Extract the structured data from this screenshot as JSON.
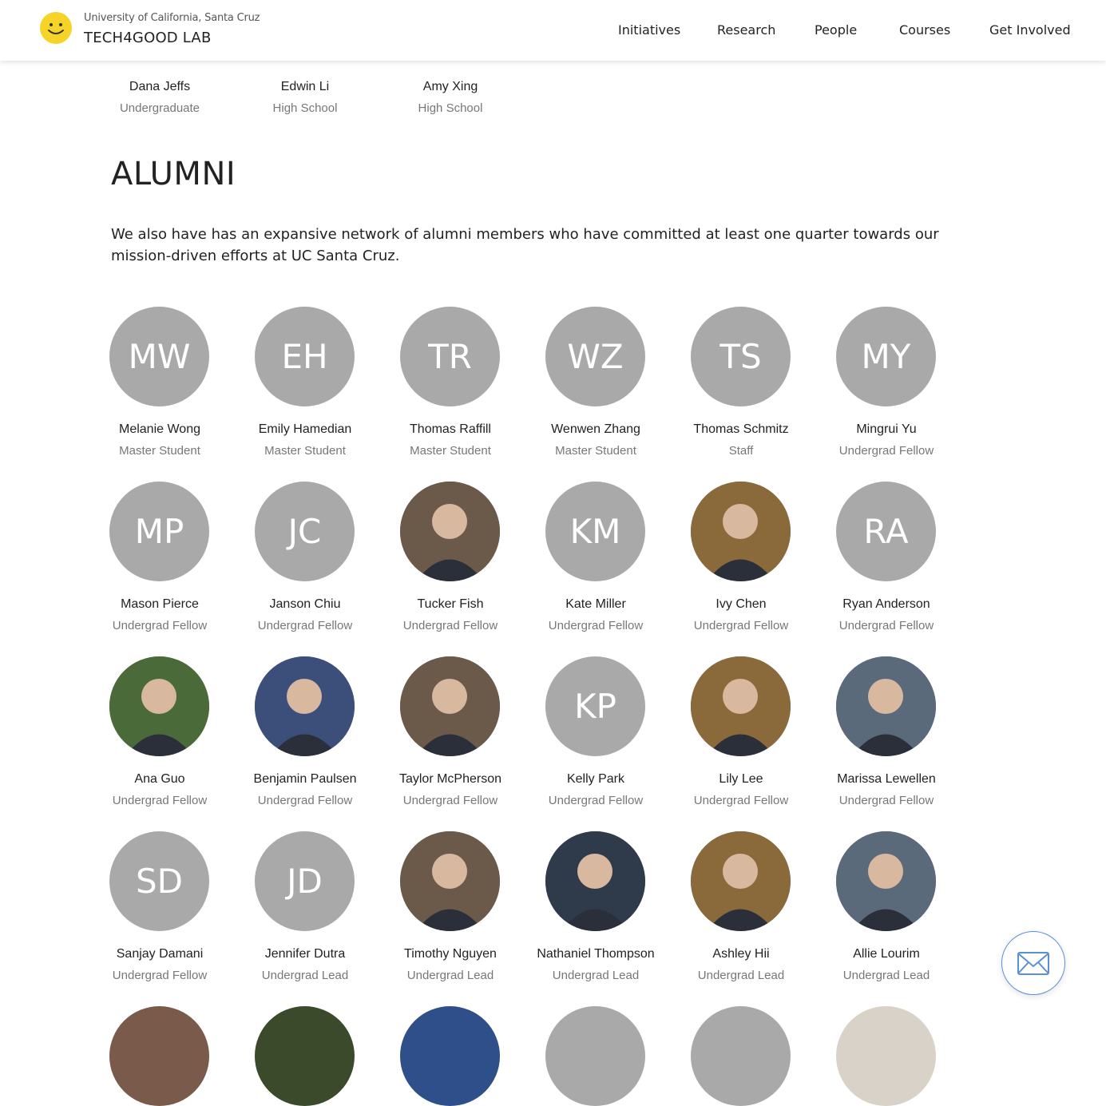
{
  "header": {
    "university": "University of California, Santa Cruz",
    "lab_name": "TECH4GOOD LAB",
    "nav": [
      "Initiatives",
      "Research",
      "People",
      "Courses",
      "Get Involved"
    ]
  },
  "top_members": [
    {
      "name": "Dana Jeffs",
      "role": "Undergraduate"
    },
    {
      "name": "Edwin Li",
      "role": "High School"
    },
    {
      "name": "Amy Xing",
      "role": "High School"
    }
  ],
  "alumni": {
    "title": "ALUMNI",
    "description": "We also have has an expansive network of alumni members who have committed at least one quarter towards our mission-driven efforts at UC Santa Cruz.",
    "members": [
      {
        "name": "Melanie Wong",
        "role": "Master Student",
        "initials": "MW",
        "photo": false
      },
      {
        "name": "Emily Hamedian",
        "role": "Master Student",
        "initials": "EH",
        "photo": false
      },
      {
        "name": "Thomas Raffill",
        "role": "Master Student",
        "initials": "TR",
        "photo": false
      },
      {
        "name": "Wenwen Zhang",
        "role": "Master Student",
        "initials": "WZ",
        "photo": false
      },
      {
        "name": "Thomas Schmitz",
        "role": "Staff",
        "initials": "TS",
        "photo": false
      },
      {
        "name": "Mingrui Yu",
        "role": "Undergrad Fellow",
        "initials": "MY",
        "photo": false
      },
      {
        "name": "Mason Pierce",
        "role": "Undergrad Fellow",
        "initials": "MP",
        "photo": false
      },
      {
        "name": "Janson Chiu",
        "role": "Undergrad Fellow",
        "initials": "JC",
        "photo": false
      },
      {
        "name": "Tucker Fish",
        "role": "Undergrad Fellow",
        "initials": "",
        "photo": true
      },
      {
        "name": "Kate Miller",
        "role": "Undergrad Fellow",
        "initials": "KM",
        "photo": false
      },
      {
        "name": "Ivy Chen",
        "role": "Undergrad Fellow",
        "initials": "",
        "photo": true
      },
      {
        "name": "Ryan Anderson",
        "role": "Undergrad Fellow",
        "initials": "RA",
        "photo": false
      },
      {
        "name": "Ana Guo",
        "role": "Undergrad Fellow",
        "initials": "",
        "photo": true
      },
      {
        "name": "Benjamin Paulsen",
        "role": "Undergrad Fellow",
        "initials": "",
        "photo": true
      },
      {
        "name": "Taylor McPherson",
        "role": "Undergrad Fellow",
        "initials": "",
        "photo": true
      },
      {
        "name": "Kelly Park",
        "role": "Undergrad Fellow",
        "initials": "KP",
        "photo": false
      },
      {
        "name": "Lily Lee",
        "role": "Undergrad Fellow",
        "initials": "",
        "photo": true
      },
      {
        "name": "Marissa Lewellen",
        "role": "Undergrad Fellow",
        "initials": "",
        "photo": true
      },
      {
        "name": "Sanjay Damani",
        "role": "Undergrad Fellow",
        "initials": "SD",
        "photo": false
      },
      {
        "name": "Jennifer Dutra",
        "role": "Undergrad Lead",
        "initials": "JD",
        "photo": false
      },
      {
        "name": "Timothy Nguyen",
        "role": "Undergrad Lead",
        "initials": "",
        "photo": true
      },
      {
        "name": "Nathaniel Thompson",
        "role": "Undergrad Lead",
        "initials": "",
        "photo": true
      },
      {
        "name": "Ashley Hii",
        "role": "Undergrad Lead",
        "initials": "",
        "photo": true
      },
      {
        "name": "Allie Lourim",
        "role": "Undergrad Lead",
        "initials": "",
        "photo": true
      }
    ]
  },
  "colors": {
    "avatar_gray": "#a9a9a9",
    "logo_yellow": "#f5d327",
    "mail_blue": "#5b8fd6"
  },
  "icons": {
    "logo": "smiley-face-icon",
    "contact": "envelope-icon"
  }
}
